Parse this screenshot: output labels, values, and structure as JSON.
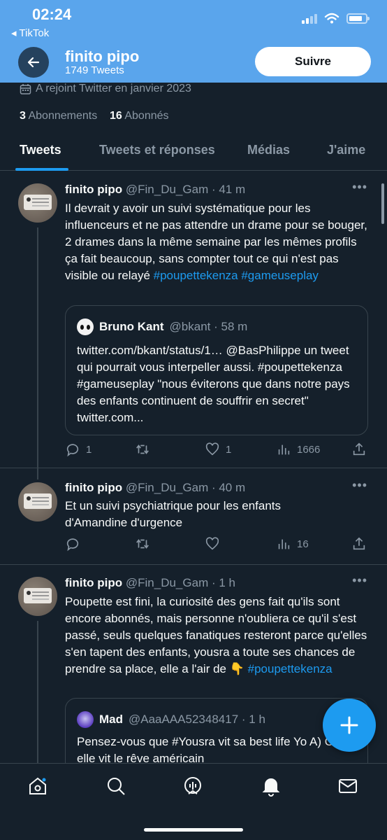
{
  "status_bar": {
    "time": "02:24",
    "back_app": "◂ TikTok"
  },
  "header": {
    "name": "finito pipo",
    "tweet_count": "1749 Tweets",
    "follow_label": "Suivre"
  },
  "profile": {
    "joined": "A rejoint Twitter en janvier 2023",
    "following_count": "3",
    "following_label": "Abonnements",
    "followers_count": "16",
    "followers_label": "Abonnés"
  },
  "tabs": [
    "Tweets",
    "Tweets et réponses",
    "Médias",
    "J'aime"
  ],
  "tweets": [
    {
      "name": "finito pipo",
      "handle": "@Fin_Du_Gam · 41 m",
      "text": "Il devrait y avoir un suivi systématique pour les influenceurs et ne pas attendre un drame pour se bouger, 2 drames dans la même semaine par les mêmes profils ça fait beaucoup, sans compter tout ce qui n'est pas visible ou relayé",
      "hashtags": "#poupettekenza #gameuseplay",
      "quote": {
        "name": "Bruno Kant",
        "handle": "@bkant · 58 m",
        "text": "twitter.com/bkant/status/1… @BasPhilippe un tweet qui pourrait vous interpeller aussi. #poupettekenza #gameuseplay \"nous éviterons que dans notre pays des enfants continuent de souffrir en secret\" twitter.com..."
      },
      "replies": "1",
      "likes": "1",
      "views": "1666"
    },
    {
      "name": "finito pipo",
      "handle": "@Fin_Du_Gam · 40 m",
      "text": "Et un suivi psychiatrique pour les enfants d'Amandine d'urgence",
      "views": "16"
    },
    {
      "name": "finito pipo",
      "handle": "@Fin_Du_Gam · 1 h",
      "text": "Poupette est fini, la curiosité des gens fait qu'ils sont encore abonnés, mais personne n'oubliera ce qu'il s'est passé, seuls quelques fanatiques resteront parce qu'elles s'en tapent des enfants, yousra a toute ses chances de prendre sa place, elle a l'air de 👇",
      "hashtags": "#poupettekenza",
      "quote": {
        "name": "Mad",
        "handle": "@AaaAAA52348417 · 1 h",
        "text": "Pensez-vous que #Yousra vit sa best life Yo A) Oui elle vit le rêve américain"
      }
    }
  ],
  "icons": [
    "back-arrow-icon",
    "calendar-icon",
    "reply-icon",
    "retweet-icon",
    "like-icon",
    "views-icon",
    "share-icon",
    "compose-icon",
    "home-icon",
    "search-icon",
    "spaces-icon",
    "notifications-icon",
    "messages-icon"
  ],
  "colors": {
    "banner": "#5aa5ec",
    "background": "#15202b",
    "accent": "#1d9bf0",
    "muted": "#8b98a5"
  }
}
